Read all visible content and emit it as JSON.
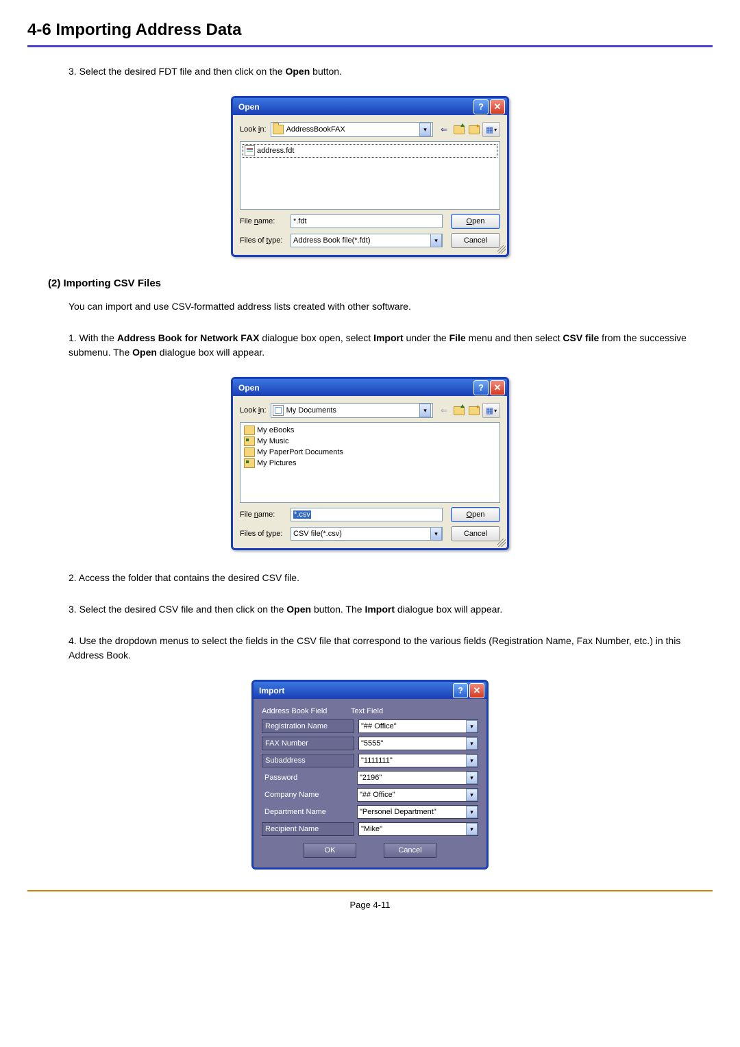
{
  "section_title": "4-6  Importing Address Data",
  "step3_prefix": "3. Select the desired FDT file and then click on the ",
  "step3_bold": "Open",
  "step3_suffix": " button.",
  "subsection_title": "(2) Importing CSV Files",
  "intro_text": "You can import and use CSV-formatted address lists created with other software.",
  "step1": {
    "prefix": "1. With the ",
    "b1": "Address Book for Network FAX",
    "mid1": " dialogue box open, select ",
    "b2": "Import",
    "mid2": " under the ",
    "b3": "File",
    "mid3": " menu and then select ",
    "b4": "CSV file",
    "mid4": " from the successive submenu. The ",
    "b5": "Open",
    "suffix": " dialogue box will appear."
  },
  "step2": "2. Access the folder that contains the desired CSV file.",
  "step3b": {
    "prefix": "3. Select the desired CSV file and then click on the ",
    "b1": "Open",
    "mid": " button. The ",
    "b2": "Import",
    "suffix": " dialogue box will appear."
  },
  "step4": "4. Use the dropdown menus to select the fields in the CSV file that correspond to the various fields (Registration Name, Fax Number, etc.) in this Address Book.",
  "page_number": "Page 4-11",
  "dialog_open": {
    "title": "Open",
    "lookin_label": "Look in:",
    "folder": "AddressBookFAX",
    "file_listed": "address.fdt",
    "filename_label": "File name:",
    "filename_value": "*.fdt",
    "filetype_label": "Files of type:",
    "filetype_value": "Address Book file(*.fdt)",
    "open_btn": "Open",
    "cancel_btn": "Cancel"
  },
  "dialog_open2": {
    "title": "Open",
    "lookin_label": "Look in:",
    "folder": "My Documents",
    "files": [
      "My eBooks",
      "My Music",
      "My PaperPort Documents",
      "My Pictures"
    ],
    "filename_label": "File name:",
    "filename_value": "*.csv",
    "filetype_label": "Files of type:",
    "filetype_value": "CSV file(*.csv)",
    "open_btn": "Open",
    "cancel_btn": "Cancel"
  },
  "dialog_import": {
    "title": "Import",
    "header_left": "Address Book Field",
    "header_right": "Text Field",
    "rows": [
      {
        "label": "Registration Name",
        "value": "\"## Office\""
      },
      {
        "label": "FAX Number",
        "value": "\"5555\""
      },
      {
        "label": "Subaddress",
        "value": "\"1111111\""
      },
      {
        "label": "Password",
        "value": "\"2196\""
      },
      {
        "label": "Company Name",
        "value": "\"## Office\""
      },
      {
        "label": "Department Name",
        "value": "\"Personel Department\""
      },
      {
        "label": "Recipient Name",
        "value": "\"Mike\""
      }
    ],
    "ok_btn": "OK",
    "cancel_btn": "Cancel"
  }
}
